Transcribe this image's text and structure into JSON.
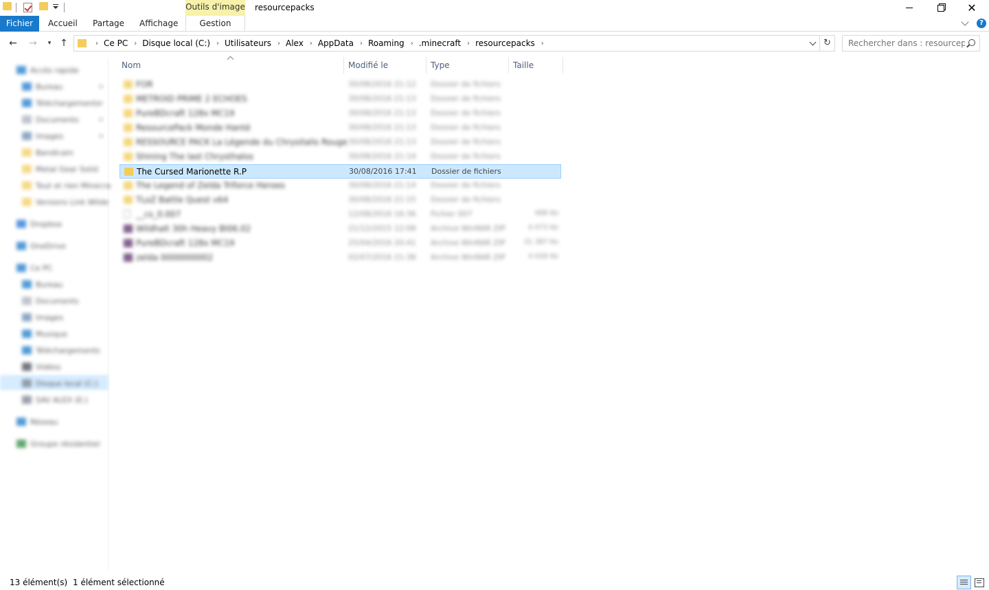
{
  "window": {
    "title": "resourcepacks",
    "context_tab_group": "Outils d'image"
  },
  "ribbon": {
    "tabs": [
      "Fichier",
      "Accueil",
      "Partage",
      "Affichage"
    ],
    "context_tab": "Gestion",
    "help_label": "?"
  },
  "address": {
    "crumbs": [
      "Ce PC",
      "Disque local (C:)",
      "Utilisateurs",
      "Alex",
      "AppData",
      "Roaming",
      ".minecraft",
      "resourcepacks"
    ]
  },
  "search": {
    "placeholder": "Rechercher dans : resourcepa..."
  },
  "nav_pane": {
    "items": [
      {
        "label": "Accès rapide",
        "icon": "star-icon",
        "color": "#1979ca",
        "pinned": false
      },
      {
        "label": "Bureau",
        "icon": "desktop-icon",
        "color": "#1979ca",
        "pinned": true
      },
      {
        "label": "Téléchargements",
        "icon": "download-icon",
        "color": "#1979ca",
        "pinned": true
      },
      {
        "label": "Documents",
        "icon": "documents-icon",
        "color": "#aab0bb",
        "pinned": true
      },
      {
        "label": "Images",
        "icon": "pictures-icon",
        "color": "#6a8bb0",
        "pinned": true
      },
      {
        "label": "Bandicam",
        "icon": "folder-icon",
        "color": "#f2cd5c",
        "pinned": false
      },
      {
        "label": "Metal Gear Solid",
        "icon": "folder-icon",
        "color": "#f2cd5c",
        "pinned": false
      },
      {
        "label": "Tout et rien Minecra",
        "icon": "folder-icon",
        "color": "#f2cd5c",
        "pinned": false
      },
      {
        "label": "Versions Link Wilde",
        "icon": "folder-icon",
        "color": "#f2cd5c",
        "pinned": false
      },
      {
        "label": "Dropbox",
        "icon": "dropbox-icon",
        "color": "#1e73d8",
        "pinned": false
      },
      {
        "label": "OneDrive",
        "icon": "onedrive-icon",
        "color": "#1979ca",
        "pinned": false
      },
      {
        "label": "Ce PC",
        "icon": "computer-icon",
        "color": "#1979ca",
        "pinned": false
      },
      {
        "label": "Bureau",
        "icon": "desktop-icon",
        "color": "#1979ca",
        "pinned": false
      },
      {
        "label": "Documents",
        "icon": "documents-icon",
        "color": "#aab0bb",
        "pinned": false
      },
      {
        "label": "Images",
        "icon": "pictures-icon",
        "color": "#6a8bb0",
        "pinned": false
      },
      {
        "label": "Musique",
        "icon": "music-icon",
        "color": "#1979ca",
        "pinned": false
      },
      {
        "label": "Téléchargements",
        "icon": "download-icon",
        "color": "#1979ca",
        "pinned": false
      },
      {
        "label": "Vidéos",
        "icon": "videos-icon",
        "color": "#444a55",
        "pinned": false
      },
      {
        "label": "Disque local (C:)",
        "icon": "drive-icon",
        "color": "#7a8290",
        "pinned": false
      },
      {
        "label": "SAV ALEX (E:)",
        "icon": "drive-icon",
        "color": "#7a8290",
        "pinned": false
      },
      {
        "label": "Réseau",
        "icon": "network-icon",
        "color": "#1979ca",
        "pinned": false
      },
      {
        "label": "Groupe résidentiel",
        "icon": "homegroup-icon",
        "color": "#2b8a3e",
        "pinned": false
      }
    ]
  },
  "columns": [
    "Nom",
    "Modifié le",
    "Type",
    "Taille"
  ],
  "files": [
    {
      "name": "FOR",
      "date": "30/08/2016 21:12",
      "type": "Dossier de fichiers",
      "size": "",
      "icon": "folder-icon",
      "blurred": true
    },
    {
      "name": "METROID PRIME 2 ECHOES",
      "date": "30/08/2016 21:13",
      "type": "Dossier de fichiers",
      "size": "",
      "icon": "folder-icon",
      "blurred": true
    },
    {
      "name": "PureBDcraft 128x MC19",
      "date": "30/08/2016 21:13",
      "type": "Dossier de fichiers",
      "size": "",
      "icon": "folder-icon",
      "blurred": true
    },
    {
      "name": "ResourcePack Monde Hanté",
      "date": "30/08/2016 21:13",
      "type": "Dossier de fichiers",
      "size": "",
      "icon": "folder-icon",
      "blurred": true
    },
    {
      "name": "RESSOURCE PACK La Légende du Chrysitalis Rouge",
      "date": "30/08/2016 21:13",
      "type": "Dossier de fichiers",
      "size": "",
      "icon": "folder-icon",
      "blurred": true
    },
    {
      "name": "Shining The last Chrysthalos",
      "date": "30/08/2016 21:14",
      "type": "Dossier de fichiers",
      "size": "",
      "icon": "folder-icon",
      "blurred": true
    },
    {
      "name": "The Cursed Marionette R.P",
      "date": "30/08/2016 17:41",
      "type": "Dossier de fichiers",
      "size": "",
      "icon": "folder-icon",
      "blurred": false
    },
    {
      "name": "The Legend of Zelda Triforce Heroes",
      "date": "30/08/2016 21:14",
      "type": "Dossier de fichiers",
      "size": "",
      "icon": "folder-icon",
      "blurred": true
    },
    {
      "name": "TLoZ Battle Quest v64",
      "date": "30/08/2016 21:15",
      "type": "Dossier de fichiers",
      "size": "",
      "icon": "folder-icon",
      "blurred": true
    },
    {
      "name": "__cs_0.007",
      "date": "12/08/2016 16:36",
      "type": "Fichier 007",
      "size": "488 Ko",
      "icon": "file-icon",
      "blurred": true
    },
    {
      "name": "Wildhalt 30h Heavy   BI06.02",
      "date": "21/12/2015 12:08",
      "type": "Archive WinRAR ZIP",
      "size": "4 073 Ko",
      "icon": "archive-icon",
      "blurred": true
    },
    {
      "name": "PureBDcraft 128x MC19",
      "date": "25/04/2016 20:41",
      "type": "Archive WinRAR ZIP",
      "size": "31 387 Ko",
      "icon": "archive-icon",
      "blurred": true
    },
    {
      "name": "zelda 0000000002",
      "date": "02/07/2016 21:38",
      "type": "Archive WinRAR ZIP",
      "size": "4 028 Ko",
      "icon": "archive-icon",
      "blurred": true
    }
  ],
  "status": {
    "count": "13 élément(s)",
    "selection": "1 élément sélectionné"
  }
}
